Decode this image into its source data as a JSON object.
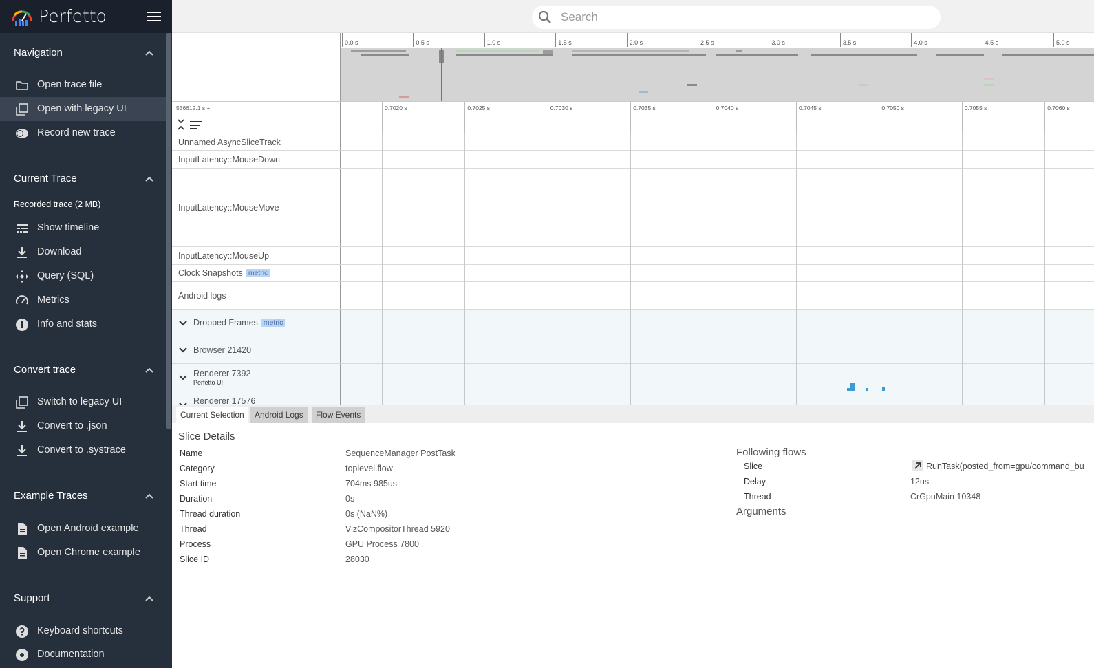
{
  "app": {
    "name": "Perfetto"
  },
  "sidebar": {
    "sections": [
      {
        "title": "Navigation",
        "items": [
          {
            "label": "Open trace file",
            "icon": "folder-icon"
          },
          {
            "label": "Open with legacy UI",
            "icon": "filter-none-icon"
          },
          {
            "label": "Record new trace",
            "icon": "toggle-icon"
          }
        ]
      },
      {
        "title": "Current Trace",
        "subtitle": "Recorded trace (2 MB)",
        "items": [
          {
            "label": "Show timeline",
            "icon": "timeline-icon"
          },
          {
            "label": "Download",
            "icon": "download-icon"
          },
          {
            "label": "Query (SQL)",
            "icon": "query-icon"
          },
          {
            "label": "Metrics",
            "icon": "speedometer-icon"
          },
          {
            "label": "Info and stats",
            "icon": "info-icon"
          }
        ]
      },
      {
        "title": "Convert trace",
        "items": [
          {
            "label": "Switch to legacy UI",
            "icon": "filter-none-icon"
          },
          {
            "label": "Convert to .json",
            "icon": "download-icon"
          },
          {
            "label": "Convert to .systrace",
            "icon": "download-icon"
          }
        ]
      },
      {
        "title": "Example Traces",
        "items": [
          {
            "label": "Open Android example",
            "icon": "document-icon"
          },
          {
            "label": "Open Chrome example",
            "icon": "document-icon"
          }
        ]
      },
      {
        "title": "Support",
        "items": [
          {
            "label": "Keyboard shortcuts",
            "icon": "help-icon"
          },
          {
            "label": "Documentation",
            "icon": "book-icon"
          }
        ]
      }
    ]
  },
  "search": {
    "placeholder": "Search"
  },
  "overview": {
    "ticks": [
      "0.0 s",
      "0.5 s",
      "1.0 s",
      "1.5 s",
      "2.0 s",
      "2.5 s",
      "3.0 s",
      "3.5 s",
      "4.0 s",
      "4.5 s",
      "5.0 s"
    ]
  },
  "axis": {
    "offset": "536612.1 s +",
    "ticks": [
      "0.7020 s",
      "0.7025 s",
      "0.7030 s",
      "0.7035 s",
      "0.7040 s",
      "0.7045 s",
      "0.7050 s",
      "0.7055 s",
      "0.7060 s"
    ]
  },
  "tracks": [
    {
      "title": "Unnamed AsyncSliceTrack"
    },
    {
      "title": "InputLatency::MouseDown"
    },
    {
      "title": "InputLatency::MouseMove"
    },
    {
      "title": "InputLatency::MouseUp"
    },
    {
      "title": "Clock Snapshots",
      "tag": "metric"
    },
    {
      "title": "Android logs"
    },
    {
      "title": "Dropped Frames",
      "tag": "metric"
    },
    {
      "title": "Browser 21420"
    },
    {
      "title": "Renderer 7392",
      "subtitle": "Perfetto UI"
    },
    {
      "title": "Renderer 17576"
    }
  ],
  "details": {
    "tabs": [
      "Current Selection",
      "Android Logs",
      "Flow Events"
    ],
    "heading": "Slice Details",
    "rows": [
      {
        "key": "Name",
        "value": "SequenceManager PostTask"
      },
      {
        "key": "Category",
        "value": "toplevel.flow"
      },
      {
        "key": "Start time",
        "value": "704ms 985us"
      },
      {
        "key": "Duration",
        "value": "0s"
      },
      {
        "key": "Thread duration",
        "value": "0s (NaN%)"
      },
      {
        "key": "Thread",
        "value": "VizCompositorThread 5920"
      },
      {
        "key": "Process",
        "value": "GPU Process 7800"
      },
      {
        "key": "Slice ID",
        "value": "28030"
      }
    ],
    "flows_heading": "Following flows",
    "flows": [
      {
        "key": "Slice",
        "value": "RunTask(posted_from=gpu/command_bu"
      },
      {
        "key": "Delay",
        "value": "12us"
      },
      {
        "key": "Thread",
        "value": "CrGpuMain 10348"
      }
    ],
    "args_heading": "Arguments"
  },
  "colors": {
    "sidebar_bg": "#262f3c",
    "sidebar_header": "#1a212c",
    "metric_tag": "#b9d4f6",
    "slice_blue": "#3d9ad6"
  }
}
